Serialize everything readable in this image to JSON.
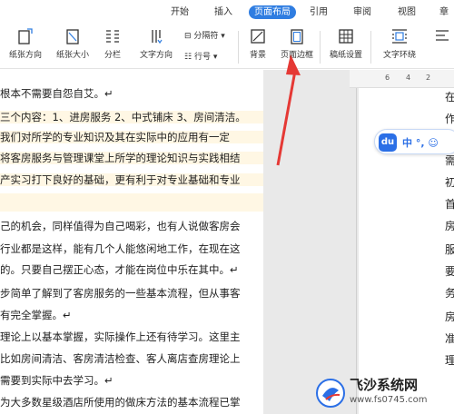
{
  "ribbon": {
    "tabs": [
      "开始",
      "插入",
      "页面布局",
      "引用",
      "审阅",
      "视图",
      "章"
    ],
    "active_tab": "页面布局",
    "tools": {
      "margins": "纸张方向",
      "size": "纸张大小",
      "columns": "分栏",
      "text_direction": "文字方向",
      "break": "分隔符",
      "line_number": "行号",
      "background": "背景",
      "page_border": "页面边框",
      "paper_setting": "稿纸设置",
      "wrap": "文字环绕"
    },
    "accent": "#2f7de1"
  },
  "ruler": {
    "ticks": [
      "6",
      "4",
      "2"
    ]
  },
  "document": {
    "lines": [
      "根本不需要自怨自艾。↵",
      "三个内容：1、进房服务 2、中式铺床 3、房间清洁。",
      "我们对所学的专业知识及其在实际中的应用有一定",
      "将客房服务与管理课堂上所学的理论知识与实践相结",
      "产实习打下良好的基础，更有利于对专业基础和专业",
      "",
      "己的机会，同样值得为自己喝彩，也有人说做客房会",
      "行业都是这样，能有几个人能悠闲地工作，在现在这",
      "的。只要自己摆正心态，才能在岗位中乐在其中。↵",
      "步简单了解到了客房服务的一些基本流程，但从事客",
      "有完全掌握。↵",
      "理论上以基本掌握，实际操作上还有待学习。这里主",
      "比如房间清洁、客房清洁检查、客人离店查房理论上",
      "需要到实际中去学习。↵",
      "为大多数星级酒店所使用的做床方法的基本流程已掌"
    ],
    "right_chars": [
      "在",
      "作",
      "",
      "",
      "需",
      "初",
      "首",
      "房",
      "服",
      "要",
      "务",
      "房",
      "准",
      "理"
    ]
  },
  "du_toolbar": {
    "logo": "du",
    "text": "中 °, ☺"
  },
  "watermark": {
    "title": "飞沙系统网",
    "url": "www.fs0745.com"
  }
}
